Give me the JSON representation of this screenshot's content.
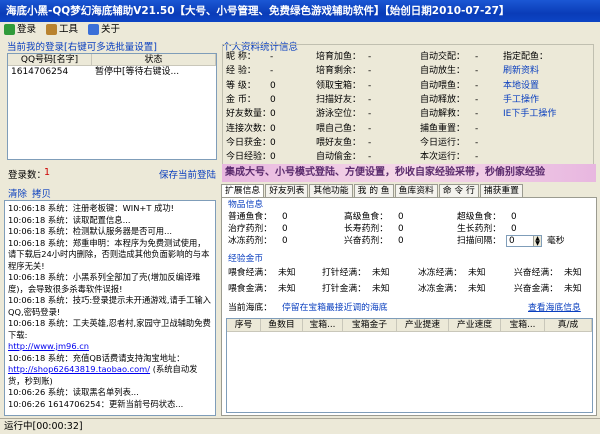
{
  "window": {
    "title": "海底小黑-QQ梦幻海底辅助V21.50【大号、小号管理、免费绿色游戏辅助软件】【始创日期2010-07-27】"
  },
  "toolbar": {
    "login": "登录",
    "tools": "工具",
    "about": "关于"
  },
  "left": {
    "current_login_label": "当前我的登录[右键可多选批量设置]",
    "columns": [
      "QQ号码[名字]",
      "状态"
    ],
    "accounts": [
      {
        "qq": "1614706254",
        "status": "暂停中[等待右键设..."
      }
    ],
    "login_count_label": "登录数：",
    "login_count": "1",
    "save_login": "保存当前登陆",
    "clear": "清除",
    "capture": "拷贝",
    "log": [
      "10:06:18 系统：注册老板键：WIN+T 成功!",
      "10:06:18 系统：读取配置信息...",
      "10:06:18 系统：检测默认服务器是否可用...",
      "10:06:18 系统：郑重申明：本程序为免费测试使用，请下载后24小时内删除，否则造成其他负面影响的与本程序无关!",
      "10:06:18 系统：小黑系列全部加了壳(增加反编译难度)，会导致很多杀毒软件误报!",
      "10:06:18 系统：技巧:登录提示未开通游戏,请手工输入QQ,密码登录!",
      "10:06:18 系统：工夫英雄,忍者村,家园守卫战辅助免费下载:",
      "10:06:18 系统：充值QB话费请支持淘宝地址：",
      "(系统自动发货，秒到账)",
      "10:06:26 系统：读取黑名单列表...",
      "10:06:26 1614706254：更新当前号码状态..."
    ],
    "log_link1": "http://www.jm96.cn",
    "log_link2": "http://shop62643819.taobao.com/"
  },
  "profile": {
    "title": "个人资料统计信息",
    "col1": [
      {
        "label": "昵 称：",
        "value": "-"
      },
      {
        "label": "经 验：",
        "value": "-"
      },
      {
        "label": "等 级：",
        "value": "0"
      },
      {
        "label": "金 币：",
        "value": "0"
      },
      {
        "label": "好友数量：",
        "value": "0"
      },
      {
        "label": "连接次数：",
        "value": "0"
      },
      {
        "label": "今日获金：",
        "value": "0"
      },
      {
        "label": "今日经验：",
        "value": "0"
      }
    ],
    "col2": [
      {
        "label": "培育加鱼：",
        "value": "-"
      },
      {
        "label": "培育剩余：",
        "value": "-"
      },
      {
        "label": "领取宝箱：",
        "value": "-"
      },
      {
        "label": "扫描好友：",
        "value": "-"
      },
      {
        "label": "游泳空位：",
        "value": "-"
      },
      {
        "label": "喂自己鱼：",
        "value": "-"
      },
      {
        "label": "喂好友鱼：",
        "value": "-"
      },
      {
        "label": "自动偷金：",
        "value": "-"
      }
    ],
    "col3": [
      {
        "label": "自动交配：",
        "value": "-"
      },
      {
        "label": "自动放生：",
        "value": "-"
      },
      {
        "label": "自动喂鱼：",
        "value": "-"
      },
      {
        "label": "自动释放：",
        "value": "-"
      },
      {
        "label": "自动解救：",
        "value": "-"
      },
      {
        "label": "捕鱼重置：",
        "value": "-"
      },
      {
        "label": "今日运行：",
        "value": "-"
      },
      {
        "label": "本次运行：",
        "value": "-"
      }
    ],
    "col4": [
      "指定配鱼：",
      "刷新资料",
      "本地设置",
      "手工操作",
      "IE下手工操作"
    ],
    "banner": "集成大号、小号模式登陆、方便设置，秒收自家经验采带，秒偷别家经验"
  },
  "tabs": [
    "扩展信息",
    "好友列表",
    "其他功能",
    "我 的 鱼",
    "鱼库资料",
    "命 令 行",
    "捕获重置"
  ],
  "extend": {
    "goods_title": "物品信息",
    "goods": [
      {
        "label": "普通鱼食：",
        "value": "0"
      },
      {
        "label": "高级鱼食：",
        "value": "0"
      },
      {
        "label": "超级鱼食：",
        "value": "0"
      },
      {
        "label": "治疗药剂：",
        "value": "0"
      },
      {
        "label": "长寿药剂：",
        "value": "0"
      },
      {
        "label": "生长药剂：",
        "value": "0"
      },
      {
        "label": "冰冻药剂：",
        "value": "0"
      },
      {
        "label": "兴奋药剂：",
        "value": "0"
      },
      {
        "label": "扫描间隔：",
        "value": "0"
      }
    ],
    "ms": "毫秒",
    "coin_title": "经验金币",
    "coin": [
      {
        "label": "喂食经满：",
        "value": "未知"
      },
      {
        "label": "打针经满：",
        "value": "未知"
      },
      {
        "label": "冰冻经满：",
        "value": "未知"
      },
      {
        "label": "兴奋经满：",
        "value": "未知"
      },
      {
        "label": "喂食金满：",
        "value": "未知"
      },
      {
        "label": "打针金满：",
        "value": "未知"
      },
      {
        "label": "冰冻金满：",
        "value": "未知"
      },
      {
        "label": "兴奋金满：",
        "value": "未知"
      }
    ],
    "sea_label": "当前海底：",
    "sea_value": "停留在宝箱最接近调的海底",
    "sea_link": "查看海底信息",
    "grid_columns": [
      "序号",
      "鱼数目",
      "宝箱...",
      "宝箱金子",
      "产业提速",
      "产业速度",
      "宝箱...",
      "真/成"
    ]
  },
  "status": {
    "text": "运行中[00:00:32]"
  }
}
